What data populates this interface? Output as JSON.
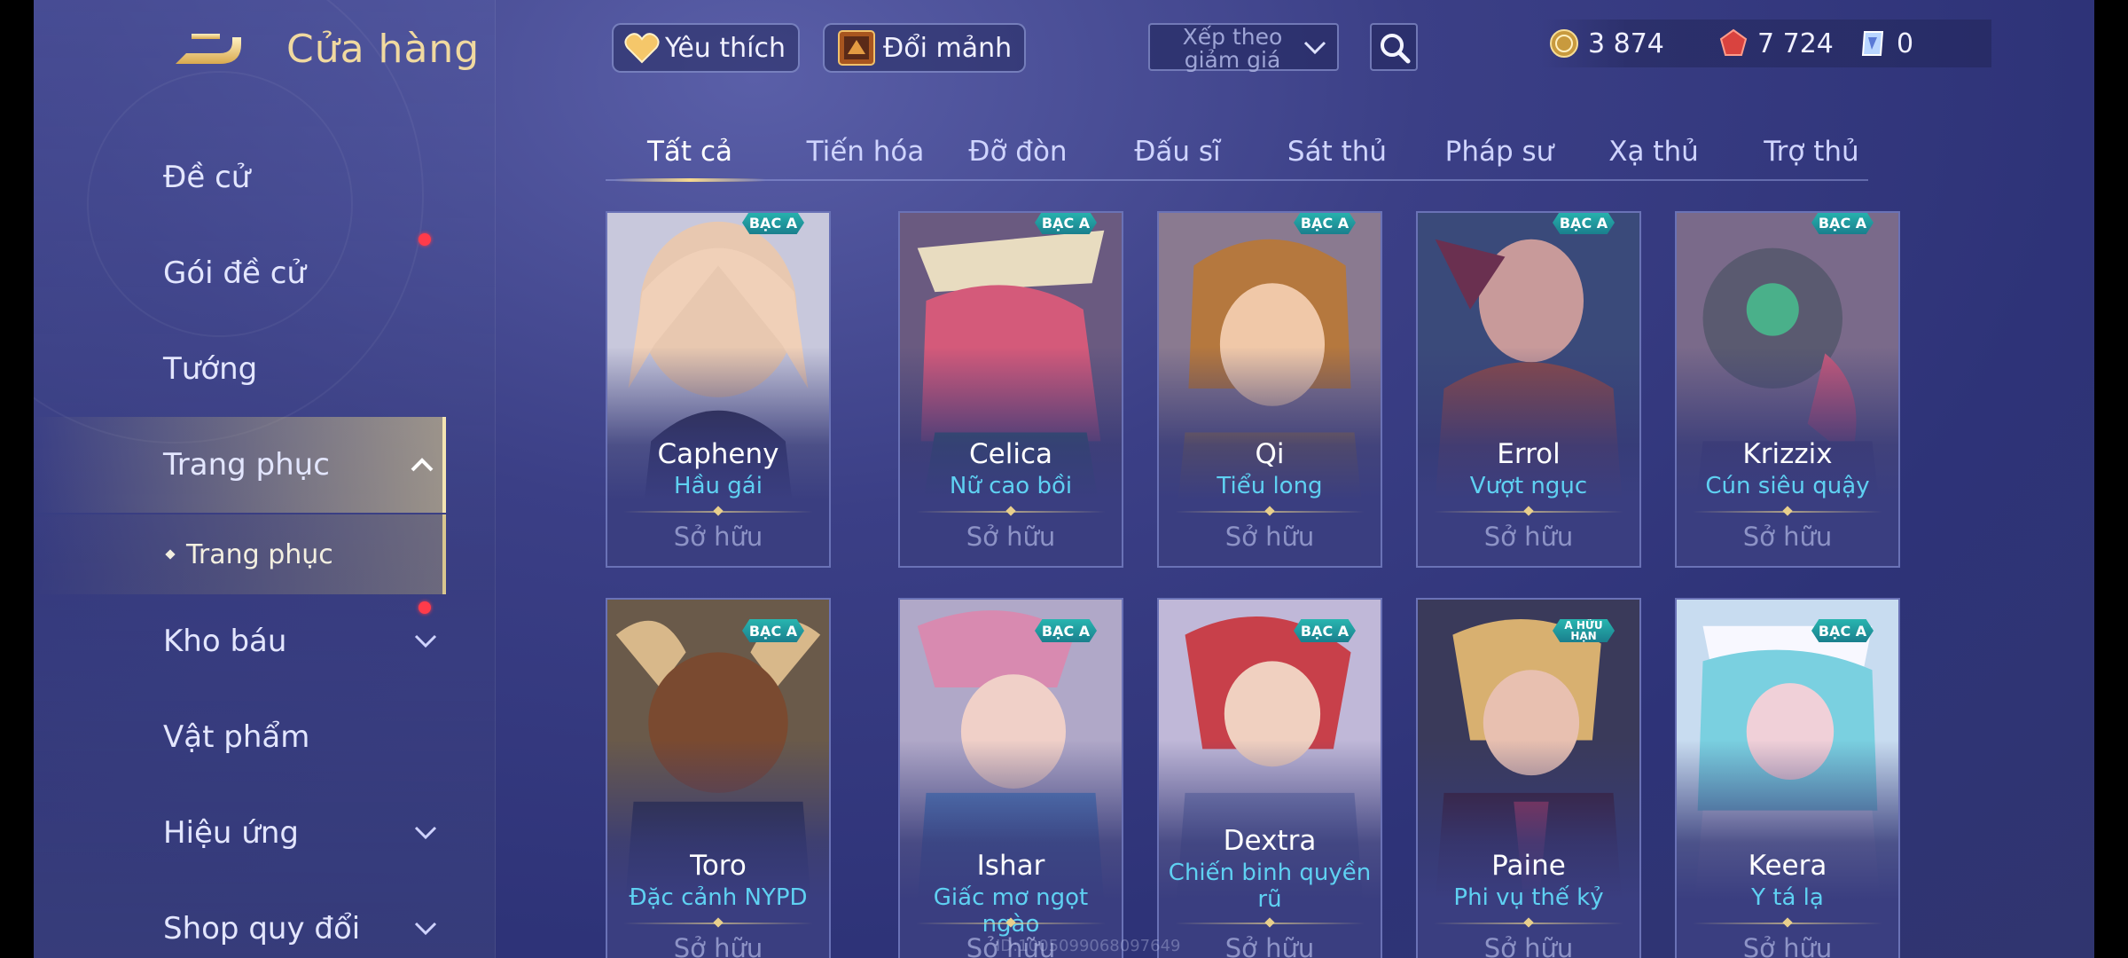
{
  "header": {
    "title": "Cửa hàng",
    "favorites_label": "Yêu thích",
    "exchange_label": "Đổi mảnh",
    "sort_label": "Xếp theo giảm giá"
  },
  "currency": {
    "gold": "3 874",
    "vouchers": "7 724",
    "shards": "0"
  },
  "sidebar": {
    "items": [
      {
        "label": "Đề cử"
      },
      {
        "label": "Gói đề cử"
      },
      {
        "label": "Tướng"
      },
      {
        "label": "Trang phục"
      },
      {
        "label": "Kho báu"
      },
      {
        "label": "Vật phẩm"
      },
      {
        "label": "Hiệu ứng"
      },
      {
        "label": "Shop quy đổi"
      }
    ],
    "sub_item": "Trang phục"
  },
  "tabs": [
    "Tất cả",
    "Tiến hóa",
    "Đỡ đòn",
    "Đấu sĩ",
    "Sát thủ",
    "Pháp sư",
    "Xạ thủ",
    "Trợ thủ"
  ],
  "cards": [
    {
      "hero": "Capheny",
      "skin": "Hầu gái",
      "badge": "BẠC A",
      "status": "Sở hữu"
    },
    {
      "hero": "Celica",
      "skin": "Nữ cao bồi",
      "badge": "BẠC A",
      "status": "Sở hữu"
    },
    {
      "hero": "Qi",
      "skin": "Tiểu long",
      "badge": "BẠC A",
      "status": "Sở hữu"
    },
    {
      "hero": "Errol",
      "skin": "Vượt ngục",
      "badge": "BẠC A",
      "status": "Sở hữu"
    },
    {
      "hero": "Krizzix",
      "skin": "Cún siêu quậy",
      "badge": "BẠC A",
      "status": "Sở hữu"
    },
    {
      "hero": "Toro",
      "skin": "Đặc cảnh NYPD",
      "badge": "BẠC A",
      "status": "Sở hữu"
    },
    {
      "hero": "Ishar",
      "skin": "Giấc mơ ngọt ngào",
      "badge": "BẠC A",
      "status": "Sở hữu"
    },
    {
      "hero": "Dextra",
      "skin": "Chiến binh quyền rũ",
      "badge": "BẠC A",
      "status": "Sở hữu"
    },
    {
      "hero": "Paine",
      "skin": "Phi vụ thế kỷ",
      "badge": "A HỮU HẠN",
      "status": "Sở hữu"
    },
    {
      "hero": "Keera",
      "skin": "Y tá lạ",
      "badge": "BẠC A",
      "status": "Sở hữu"
    }
  ],
  "watermark": "ID:1005099068097649"
}
